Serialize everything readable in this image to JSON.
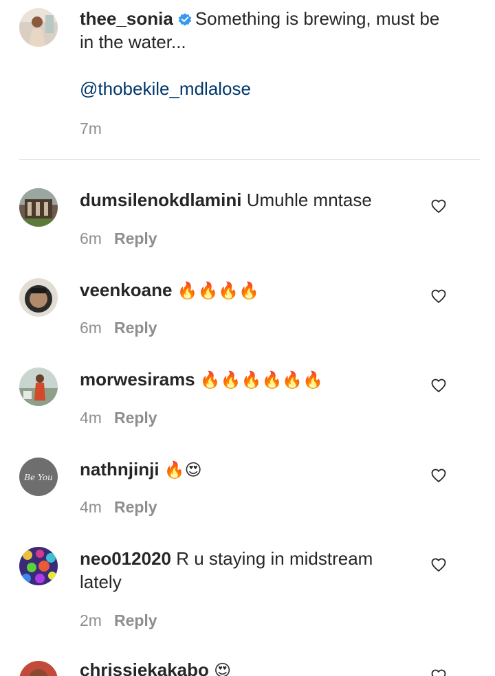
{
  "post": {
    "username": "thee_sonia",
    "text": "Something is brewing, must be in the water...",
    "mention": "@thobekile_mdlalose",
    "time": "7m"
  },
  "comments": [
    {
      "username": "dumsilenokdlamini",
      "text": "Umuhle mntase",
      "emoji": "",
      "time": "6m",
      "reply": "Reply"
    },
    {
      "username": "veenkoane",
      "text": "",
      "emoji": "🔥🔥🔥🔥",
      "time": "6m",
      "reply": "Reply"
    },
    {
      "username": "morwesirams",
      "text": "",
      "emoji": "🔥🔥🔥🔥🔥🔥",
      "time": "4m",
      "reply": "Reply"
    },
    {
      "username": "nathnjinji",
      "text": "",
      "emoji": "🔥😍",
      "time": "4m",
      "reply": "Reply"
    },
    {
      "username": "neo012020",
      "text": "R u staying in midstream lately",
      "emoji": "",
      "time": "2m",
      "reply": "Reply"
    },
    {
      "username": "chrissiekakabo",
      "text": "",
      "emoji": "😍",
      "time": "",
      "reply": ""
    }
  ],
  "icons": {
    "verified": "verified-badge-icon",
    "like": "heart-outline-icon"
  },
  "colors": {
    "text": "#262626",
    "meta": "#8e8e8e",
    "mention": "#00376b",
    "verified": "#3897f0",
    "divider": "#dbdbdb"
  },
  "avatar_labels": {
    "nathnjinji": "Be You"
  }
}
